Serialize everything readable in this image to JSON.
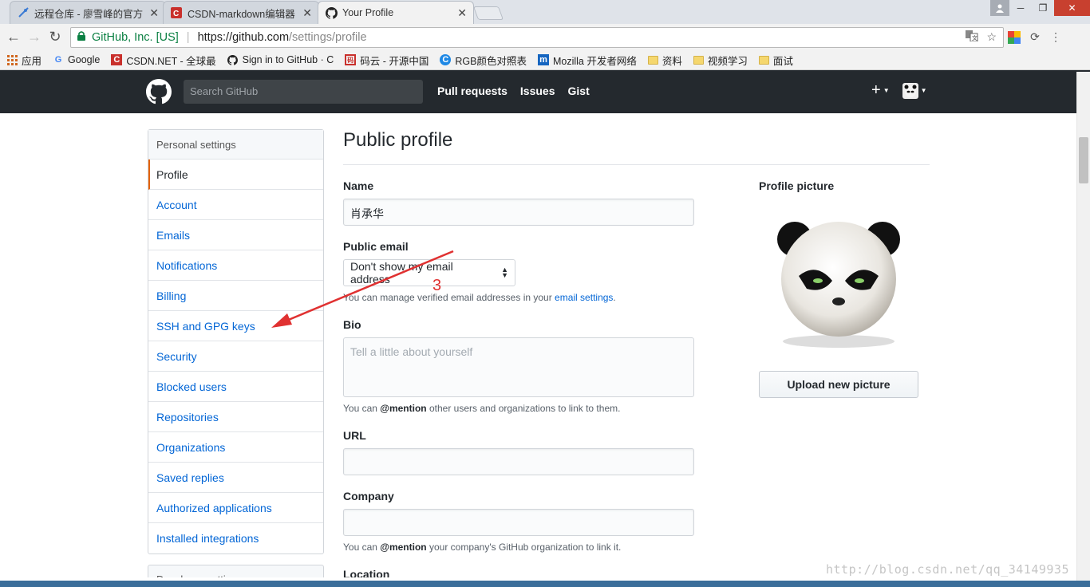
{
  "tabs": [
    {
      "title": "远程仓库 - 廖雪峰的官方",
      "icon": "rocket-icon"
    },
    {
      "title": "CSDN-markdown编辑器",
      "icon": "csdn-icon"
    },
    {
      "title": "Your Profile",
      "icon": "github-icon"
    }
  ],
  "address": {
    "identity": "GitHub, Inc. [US]",
    "host": "https://github.com",
    "path": "/settings/profile"
  },
  "bookmarks": [
    {
      "label": "应用",
      "icon": "apps-icon"
    },
    {
      "label": "Google",
      "icon": "google-icon"
    },
    {
      "label": "CSDN.NET - 全球最",
      "icon": "csdn-icon"
    },
    {
      "label": "Sign in to GitHub · C",
      "icon": "github-icon"
    },
    {
      "label": "码云 - 开源中国",
      "icon": "gitee-icon"
    },
    {
      "label": "RGB颜色对照表",
      "icon": "rgb-icon"
    },
    {
      "label": "Mozilla 开发者网络",
      "icon": "mozilla-icon"
    },
    {
      "label": "资料",
      "icon": "folder-icon"
    },
    {
      "label": "视频学习",
      "icon": "folder-icon"
    },
    {
      "label": "面试",
      "icon": "folder-icon"
    }
  ],
  "header": {
    "search_placeholder": "Search GitHub",
    "nav": [
      "Pull requests",
      "Issues",
      "Gist"
    ]
  },
  "sidebar": {
    "heading": "Personal settings",
    "items": [
      "Profile",
      "Account",
      "Emails",
      "Notifications",
      "Billing",
      "SSH and GPG keys",
      "Security",
      "Blocked users",
      "Repositories",
      "Organizations",
      "Saved replies",
      "Authorized applications",
      "Installed integrations"
    ],
    "selected": "Profile",
    "next_heading": "Developer settings"
  },
  "main": {
    "title": "Public profile",
    "name_label": "Name",
    "name_value": "肖承华",
    "email_label": "Public email",
    "email_value": "Don't show my email address",
    "email_note_pre": "You can manage verified email addresses in your ",
    "email_note_link": "email settings",
    "email_note_post": ".",
    "bio_label": "Bio",
    "bio_placeholder": "Tell a little about yourself",
    "bio_note_pre": "You can ",
    "bio_note_bold": "@mention",
    "bio_note_post": " other users and organizations to link to them.",
    "url_label": "URL",
    "company_label": "Company",
    "company_note_pre": "You can ",
    "company_note_bold": "@mention",
    "company_note_post": " your company's GitHub organization to link it.",
    "location_label": "Location"
  },
  "profile_picture": {
    "label": "Profile picture",
    "upload_label": "Upload new picture"
  },
  "annotation": {
    "number": "3"
  },
  "watermark": "http://blog.csdn.net/qq_34149935",
  "colors": {
    "github_dark": "#24292e",
    "link": "#0366d6",
    "selected_border": "#e36209",
    "annotation": "#e03131"
  }
}
